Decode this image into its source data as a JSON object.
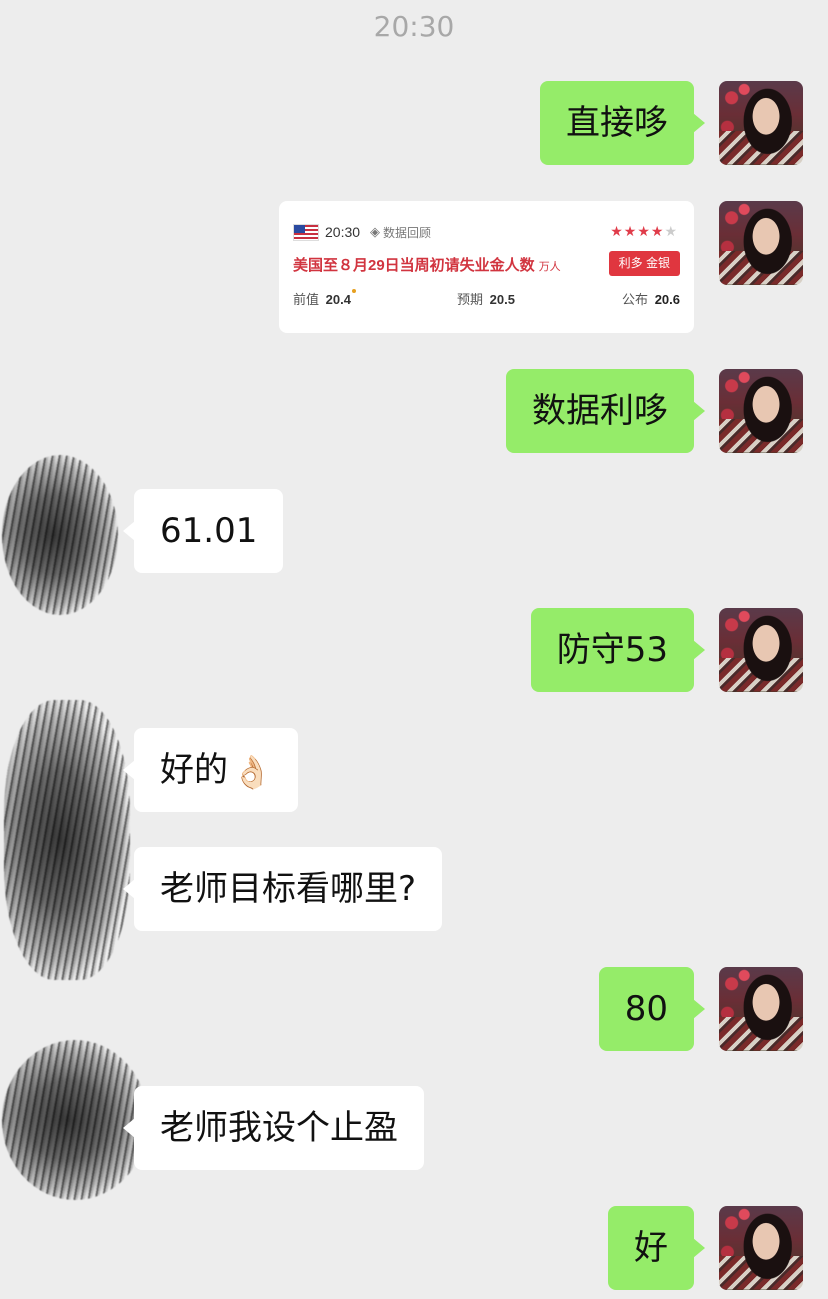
{
  "timestamp": "20:30",
  "messages": [
    {
      "from": "me",
      "text": "直接哆"
    },
    {
      "from": "me",
      "type": "card"
    },
    {
      "from": "me",
      "text": "数据利哆"
    },
    {
      "from": "other",
      "text": "61.01"
    },
    {
      "from": "me",
      "text": "防守53"
    },
    {
      "from": "other",
      "text": "好的",
      "emoji": "👌🏻"
    },
    {
      "from": "other",
      "text": "老师目标看哪里?"
    },
    {
      "from": "me",
      "text": "80"
    },
    {
      "from": "other",
      "text": "老师我设个止盈"
    },
    {
      "from": "me",
      "text": "好"
    }
  ],
  "card": {
    "flag": "us-flag-icon",
    "time": "20:30",
    "tag_icon": "layers-icon",
    "tag": "数据回顾",
    "stars_filled": 4,
    "stars_total": 5,
    "title": "美国至８月29日当周初请失业金人数",
    "unit": "万人",
    "badge": "利多 金银",
    "prev_label": "前值",
    "prev_value": "20.4",
    "expect_label": "预期",
    "expect_value": "20.5",
    "publish_label": "公布",
    "publish_value": "20.6",
    "star_color": "#e03c4a",
    "badge_color": "#e0363f"
  },
  "colors": {
    "background": "#ededed",
    "me_bubble": "#95ec69",
    "other_bubble": "#ffffff"
  }
}
